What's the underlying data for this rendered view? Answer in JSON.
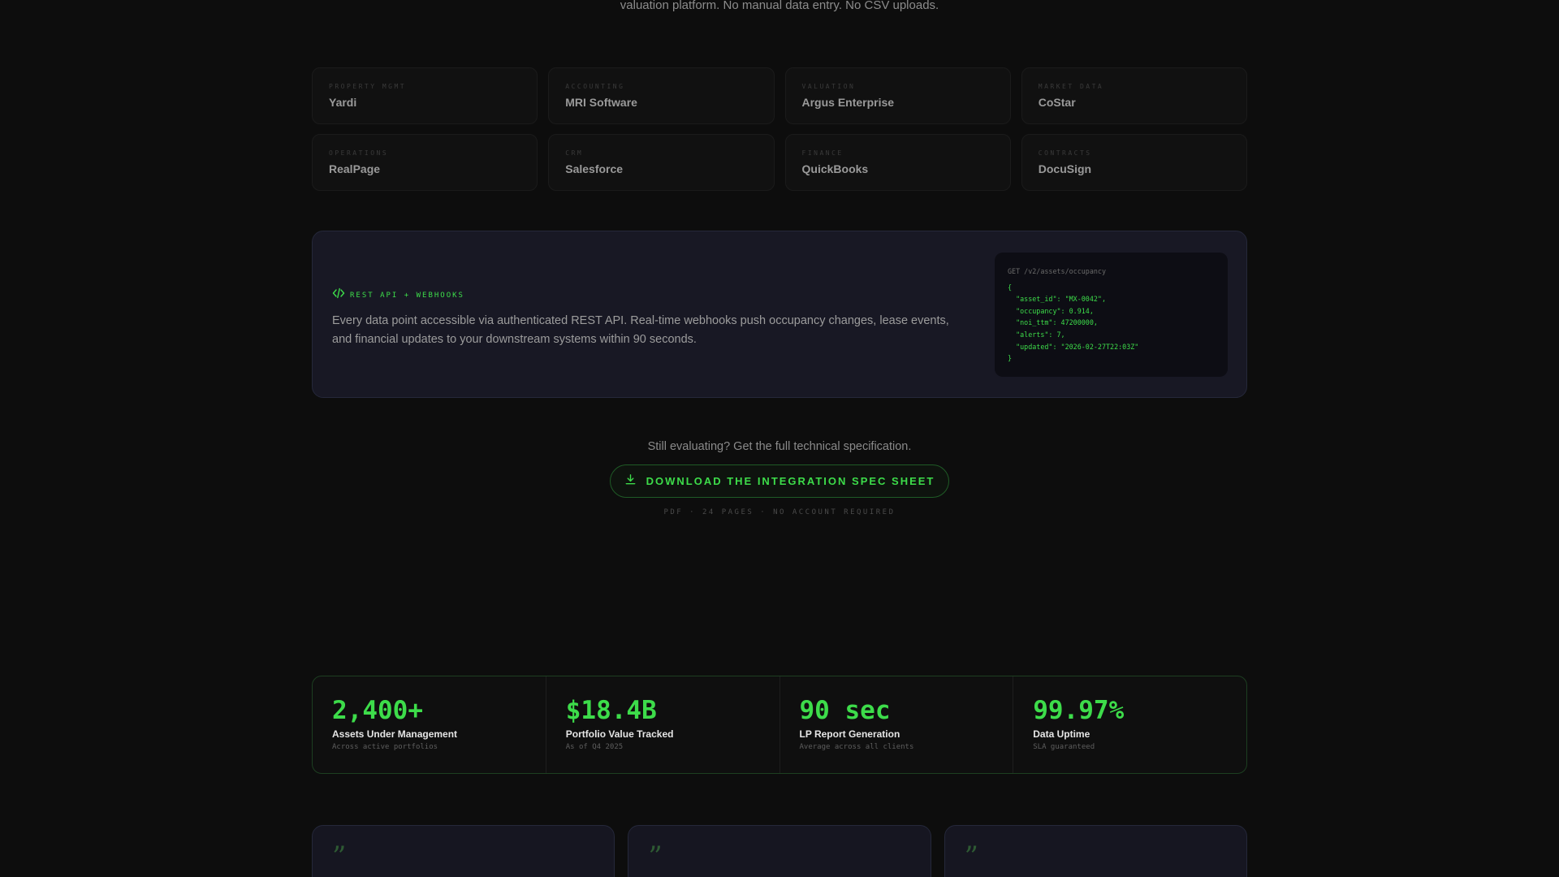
{
  "intro": {
    "text": "valuation platform. No manual data entry. No CSV uploads."
  },
  "integrations": [
    {
      "category": "Property Mgmt",
      "name": "Yardi"
    },
    {
      "category": "Accounting",
      "name": "MRI Software"
    },
    {
      "category": "Valuation",
      "name": "Argus Enterprise"
    },
    {
      "category": "Market Data",
      "name": "CoStar"
    },
    {
      "category": "Operations",
      "name": "RealPage"
    },
    {
      "category": "CRM",
      "name": "Salesforce"
    },
    {
      "category": "Finance",
      "name": "QuickBooks"
    },
    {
      "category": "Contracts",
      "name": "DocuSign"
    }
  ],
  "api": {
    "tag": "REST API + Webhooks",
    "tag_icon": "code-icon",
    "description": "Every data point accessible via authenticated REST API. Real-time webhooks push occupancy changes, lease events, and financial updates to your downstream systems within 90 seconds.",
    "code": {
      "request": "GET /v2/assets/occupancy",
      "lines": [
        "{",
        "  \"asset_id\": \"MX-0042\",",
        "  \"occupancy\": 0.914,",
        "  \"noi_ttm\": 47200000,",
        "  \"alerts\": 7,",
        "  \"updated\": \"2026-02-27T22:03Z\"",
        "}"
      ]
    }
  },
  "cta": {
    "question": "Still evaluating? Get the full technical specification.",
    "button_label": "Download the Integration Spec Sheet",
    "button_icon": "download-icon",
    "meta": "PDF · 24 pages · No account required"
  },
  "stats": [
    {
      "value": "2,400+",
      "label": "Assets Under Management",
      "sub": "Across active portfolios"
    },
    {
      "value": "$18.4B",
      "label": "Portfolio Value Tracked",
      "sub": "As of Q4 2025"
    },
    {
      "value": "90 sec",
      "label": "LP Report Generation",
      "sub": "Average across all clients"
    },
    {
      "value": "99.97%",
      "label": "Data Uptime",
      "sub": "SLA guaranteed"
    }
  ],
  "testimonials": [
    {
      "quote_mark": "”"
    },
    {
      "quote_mark": "”"
    },
    {
      "quote_mark": "”"
    }
  ],
  "colors": {
    "accent": "#3ddc4a",
    "background": "#0d0d0d",
    "panel": "#181824"
  }
}
